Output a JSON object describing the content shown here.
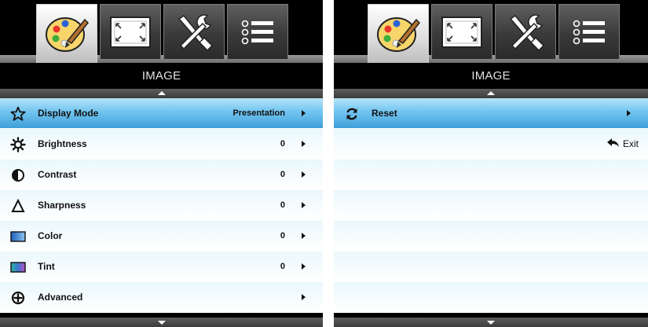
{
  "left_menu": {
    "tabs": [
      {
        "icon": "palette-icon",
        "active": true
      },
      {
        "icon": "screen-icon",
        "active": false
      },
      {
        "icon": "tools-icon",
        "active": false
      },
      {
        "icon": "list-icon",
        "active": false
      }
    ],
    "title": "IMAGE",
    "items": [
      {
        "label": "Display Mode",
        "value": "Presentation",
        "icon": "star-icon",
        "selected": true
      },
      {
        "label": "Brightness",
        "value": "0",
        "icon": "sun-icon"
      },
      {
        "label": "Contrast",
        "value": "0",
        "icon": "contrast-icon"
      },
      {
        "label": "Sharpness",
        "value": "0",
        "icon": "delta-icon"
      },
      {
        "label": "Color",
        "value": "0",
        "icon": "color-swatch-icon"
      },
      {
        "label": "Tint",
        "value": "0",
        "icon": "tint-swatch-icon"
      },
      {
        "label": "Advanced",
        "value": "",
        "icon": "circle-plus-icon"
      }
    ]
  },
  "right_menu": {
    "title": "IMAGE",
    "items": [
      {
        "label": "Reset",
        "icon": "refresh-icon",
        "selected": true
      }
    ],
    "exit_label": "Exit",
    "exit_icon": "return-arrow-icon"
  },
  "colors": {
    "selected_row": "#3f9fd9",
    "row_bg": "#eaf8fc",
    "frame": "#000000"
  }
}
